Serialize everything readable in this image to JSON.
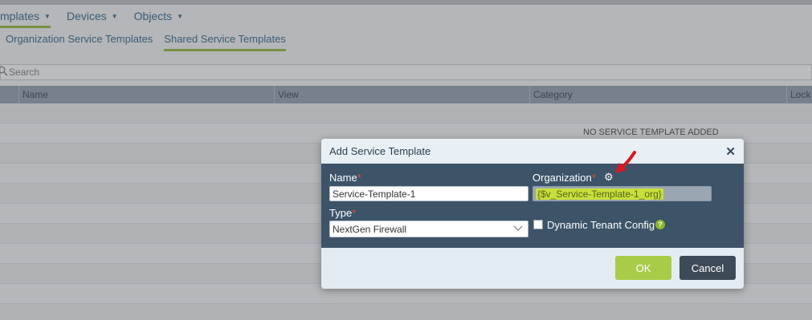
{
  "top_nav": {
    "items": [
      {
        "label": "mplates",
        "active": true
      },
      {
        "label": "Devices",
        "active": false
      },
      {
        "label": "Objects",
        "active": false
      }
    ]
  },
  "sub_nav": {
    "items": [
      {
        "label": "Organization Service Templates",
        "active": false
      },
      {
        "label": "Shared Service Templates",
        "active": true
      }
    ]
  },
  "search": {
    "placeholder": "Search"
  },
  "table": {
    "columns": [
      "Name",
      "View",
      "Category",
      "Lock"
    ],
    "empty_message": "NO SERVICE TEMPLATE ADDED"
  },
  "dialog": {
    "title": "Add Service Template",
    "name_label": "Name",
    "name_value": "Service-Template-1",
    "organization_label": "Organization",
    "organization_value": "{$v_Service-Template-1_org}",
    "type_label": "Type",
    "type_value": "NextGen Firewall",
    "dynamic_label": "Dynamic Tenant Config",
    "help_glyph": "?",
    "ok_label": "OK",
    "cancel_label": "Cancel"
  },
  "colors": {
    "accent": "#8cb62a",
    "modal_body": "#3d5368",
    "highlight": "#c8e03a",
    "arrow": "#e0161b"
  }
}
